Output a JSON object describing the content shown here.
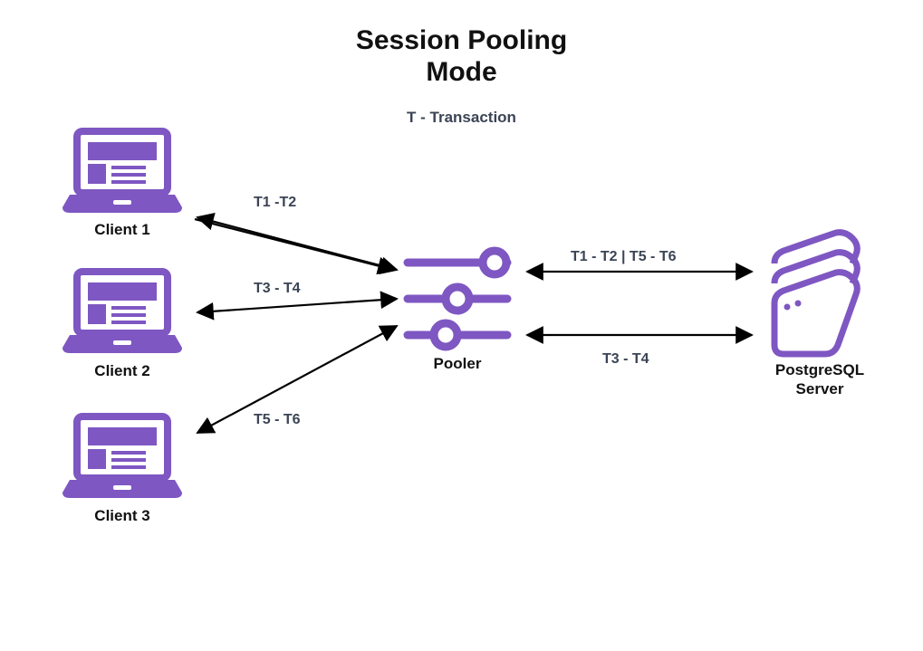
{
  "title_line1": "Session Pooling",
  "title_line2": "Mode",
  "legend": "T - Transaction",
  "colors": {
    "accent": "#7E57C2",
    "text_muted": "#3b4455"
  },
  "nodes": {
    "client1": {
      "label": "Client 1"
    },
    "client2": {
      "label": "Client 2"
    },
    "client3": {
      "label": "Client 3"
    },
    "pooler": {
      "label": "Pooler"
    },
    "server": {
      "label_line1": "PostgreSQL",
      "label_line2": "Server"
    }
  },
  "edges": {
    "c1_pooler": {
      "label": "T1 -T2"
    },
    "c2_pooler": {
      "label": "T3 - T4"
    },
    "c3_pooler": {
      "label": "T5 - T6"
    },
    "pooler_server_top": {
      "label": "T1 - T2 | T5 - T6"
    },
    "pooler_server_bottom": {
      "label": "T3 - T4"
    }
  }
}
